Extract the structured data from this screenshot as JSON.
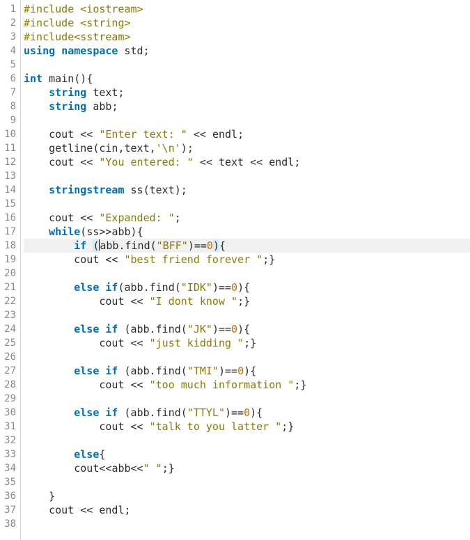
{
  "editor": {
    "highlighted_line": 18,
    "caret": {
      "line": 18,
      "col_after": "("
    },
    "line_count": 38,
    "lines": [
      {
        "n": 1,
        "tokens": [
          {
            "t": "#include ",
            "c": "pre"
          },
          {
            "t": "<iostream>",
            "c": "ang"
          }
        ]
      },
      {
        "n": 2,
        "tokens": [
          {
            "t": "#include ",
            "c": "pre"
          },
          {
            "t": "<string>",
            "c": "ang"
          }
        ]
      },
      {
        "n": 3,
        "tokens": [
          {
            "t": "#include",
            "c": "pre"
          },
          {
            "t": "<sstream>",
            "c": "ang"
          }
        ]
      },
      {
        "n": 4,
        "tokens": [
          {
            "t": "using",
            "c": "kw"
          },
          {
            "t": " ",
            "c": "id"
          },
          {
            "t": "namespace",
            "c": "kw"
          },
          {
            "t": " ",
            "c": "id"
          },
          {
            "t": "std",
            "c": "id"
          },
          {
            "t": ";",
            "c": "pun"
          }
        ]
      },
      {
        "n": 5,
        "tokens": []
      },
      {
        "n": 6,
        "tokens": [
          {
            "t": "int",
            "c": "type"
          },
          {
            "t": " ",
            "c": "id"
          },
          {
            "t": "main",
            "c": "func"
          },
          {
            "t": "()",
            "c": "pun"
          },
          {
            "t": "{",
            "c": "br"
          }
        ]
      },
      {
        "n": 7,
        "tokens": [
          {
            "t": "    ",
            "c": "id"
          },
          {
            "t": "string",
            "c": "type"
          },
          {
            "t": " ",
            "c": "id"
          },
          {
            "t": "text",
            "c": "id"
          },
          {
            "t": ";",
            "c": "pun"
          }
        ]
      },
      {
        "n": 8,
        "tokens": [
          {
            "t": "    ",
            "c": "id"
          },
          {
            "t": "string",
            "c": "type"
          },
          {
            "t": " ",
            "c": "id"
          },
          {
            "t": "abb",
            "c": "id"
          },
          {
            "t": ";",
            "c": "pun"
          }
        ]
      },
      {
        "n": 9,
        "tokens": []
      },
      {
        "n": 10,
        "tokens": [
          {
            "t": "    ",
            "c": "id"
          },
          {
            "t": "cout",
            "c": "id"
          },
          {
            "t": " ",
            "c": "id"
          },
          {
            "t": "<<",
            "c": "op"
          },
          {
            "t": " ",
            "c": "id"
          },
          {
            "t": "\"Enter text: \"",
            "c": "str"
          },
          {
            "t": " ",
            "c": "id"
          },
          {
            "t": "<<",
            "c": "op"
          },
          {
            "t": " ",
            "c": "id"
          },
          {
            "t": "endl",
            "c": "id"
          },
          {
            "t": ";",
            "c": "pun"
          }
        ]
      },
      {
        "n": 11,
        "tokens": [
          {
            "t": "    ",
            "c": "id"
          },
          {
            "t": "getline",
            "c": "func"
          },
          {
            "t": "(",
            "c": "pun"
          },
          {
            "t": "cin",
            "c": "id"
          },
          {
            "t": ",",
            "c": "pun"
          },
          {
            "t": "text",
            "c": "id"
          },
          {
            "t": ",",
            "c": "pun"
          },
          {
            "t": "'\\n'",
            "c": "str"
          },
          {
            "t": ")",
            "c": "pun"
          },
          {
            "t": ";",
            "c": "pun"
          }
        ]
      },
      {
        "n": 12,
        "tokens": [
          {
            "t": "    ",
            "c": "id"
          },
          {
            "t": "cout",
            "c": "id"
          },
          {
            "t": " ",
            "c": "id"
          },
          {
            "t": "<<",
            "c": "op"
          },
          {
            "t": " ",
            "c": "id"
          },
          {
            "t": "\"You entered: \"",
            "c": "str"
          },
          {
            "t": " ",
            "c": "id"
          },
          {
            "t": "<<",
            "c": "op"
          },
          {
            "t": " ",
            "c": "id"
          },
          {
            "t": "text",
            "c": "id"
          },
          {
            "t": " ",
            "c": "id"
          },
          {
            "t": "<<",
            "c": "op"
          },
          {
            "t": " ",
            "c": "id"
          },
          {
            "t": "endl",
            "c": "id"
          },
          {
            "t": ";",
            "c": "pun"
          }
        ]
      },
      {
        "n": 13,
        "tokens": []
      },
      {
        "n": 14,
        "tokens": [
          {
            "t": "    ",
            "c": "id"
          },
          {
            "t": "stringstream",
            "c": "type"
          },
          {
            "t": " ",
            "c": "id"
          },
          {
            "t": "ss",
            "c": "id"
          },
          {
            "t": "(",
            "c": "pun"
          },
          {
            "t": "text",
            "c": "id"
          },
          {
            "t": ")",
            "c": "pun"
          },
          {
            "t": ";",
            "c": "pun"
          }
        ]
      },
      {
        "n": 15,
        "tokens": []
      },
      {
        "n": 16,
        "tokens": [
          {
            "t": "    ",
            "c": "id"
          },
          {
            "t": "cout",
            "c": "id"
          },
          {
            "t": " ",
            "c": "id"
          },
          {
            "t": "<<",
            "c": "op"
          },
          {
            "t": " ",
            "c": "id"
          },
          {
            "t": "\"Expanded: \"",
            "c": "str"
          },
          {
            "t": ";",
            "c": "pun"
          }
        ]
      },
      {
        "n": 17,
        "tokens": [
          {
            "t": "    ",
            "c": "id"
          },
          {
            "t": "while",
            "c": "kw"
          },
          {
            "t": "(",
            "c": "pun"
          },
          {
            "t": "ss",
            "c": "id"
          },
          {
            "t": ">>",
            "c": "op"
          },
          {
            "t": "abb",
            "c": "id"
          },
          {
            "t": ")",
            "c": "pun"
          },
          {
            "t": "{",
            "c": "br"
          }
        ]
      },
      {
        "n": 18,
        "hl": true,
        "tokens": [
          {
            "t": "        ",
            "c": "id"
          },
          {
            "t": "if",
            "c": "kw"
          },
          {
            "t": " ",
            "c": "id"
          },
          {
            "t": "(",
            "c": "brh"
          },
          {
            "caret": true
          },
          {
            "t": "abb",
            "c": "id"
          },
          {
            "t": ".",
            "c": "pun"
          },
          {
            "t": "find",
            "c": "func"
          },
          {
            "t": "(",
            "c": "pun"
          },
          {
            "t": "\"BFF\"",
            "c": "str"
          },
          {
            "t": ")",
            "c": "pun"
          },
          {
            "t": "==",
            "c": "op"
          },
          {
            "t": "0",
            "c": "num"
          },
          {
            "t": ")",
            "c": "brh"
          },
          {
            "t": "{",
            "c": "br"
          }
        ]
      },
      {
        "n": 19,
        "tokens": [
          {
            "t": "        ",
            "c": "id"
          },
          {
            "t": "cout",
            "c": "id"
          },
          {
            "t": " ",
            "c": "id"
          },
          {
            "t": "<<",
            "c": "op"
          },
          {
            "t": " ",
            "c": "id"
          },
          {
            "t": "\"best friend forever \"",
            "c": "str"
          },
          {
            "t": ";",
            "c": "pun"
          },
          {
            "t": "}",
            "c": "br"
          }
        ]
      },
      {
        "n": 20,
        "tokens": []
      },
      {
        "n": 21,
        "tokens": [
          {
            "t": "        ",
            "c": "id"
          },
          {
            "t": "else",
            "c": "kw"
          },
          {
            "t": " ",
            "c": "id"
          },
          {
            "t": "if",
            "c": "kw"
          },
          {
            "t": "(",
            "c": "pun"
          },
          {
            "t": "abb",
            "c": "id"
          },
          {
            "t": ".",
            "c": "pun"
          },
          {
            "t": "find",
            "c": "func"
          },
          {
            "t": "(",
            "c": "pun"
          },
          {
            "t": "\"IDK\"",
            "c": "str"
          },
          {
            "t": ")",
            "c": "pun"
          },
          {
            "t": "==",
            "c": "op"
          },
          {
            "t": "0",
            "c": "num"
          },
          {
            "t": ")",
            "c": "pun"
          },
          {
            "t": "{",
            "c": "br"
          }
        ]
      },
      {
        "n": 22,
        "tokens": [
          {
            "t": "            ",
            "c": "id"
          },
          {
            "t": "cout",
            "c": "id"
          },
          {
            "t": " ",
            "c": "id"
          },
          {
            "t": "<<",
            "c": "op"
          },
          {
            "t": " ",
            "c": "id"
          },
          {
            "t": "\"I dont know \"",
            "c": "str"
          },
          {
            "t": ";",
            "c": "pun"
          },
          {
            "t": "}",
            "c": "br"
          }
        ]
      },
      {
        "n": 23,
        "tokens": []
      },
      {
        "n": 24,
        "tokens": [
          {
            "t": "        ",
            "c": "id"
          },
          {
            "t": "else",
            "c": "kw"
          },
          {
            "t": " ",
            "c": "id"
          },
          {
            "t": "if",
            "c": "kw"
          },
          {
            "t": " ",
            "c": "id"
          },
          {
            "t": "(",
            "c": "pun"
          },
          {
            "t": "abb",
            "c": "id"
          },
          {
            "t": ".",
            "c": "pun"
          },
          {
            "t": "find",
            "c": "func"
          },
          {
            "t": "(",
            "c": "pun"
          },
          {
            "t": "\"JK\"",
            "c": "str"
          },
          {
            "t": ")",
            "c": "pun"
          },
          {
            "t": "==",
            "c": "op"
          },
          {
            "t": "0",
            "c": "num"
          },
          {
            "t": ")",
            "c": "pun"
          },
          {
            "t": "{",
            "c": "br"
          }
        ]
      },
      {
        "n": 25,
        "tokens": [
          {
            "t": "            ",
            "c": "id"
          },
          {
            "t": "cout",
            "c": "id"
          },
          {
            "t": " ",
            "c": "id"
          },
          {
            "t": "<<",
            "c": "op"
          },
          {
            "t": " ",
            "c": "id"
          },
          {
            "t": "\"just kidding \"",
            "c": "str"
          },
          {
            "t": ";",
            "c": "pun"
          },
          {
            "t": "}",
            "c": "br"
          }
        ]
      },
      {
        "n": 26,
        "tokens": []
      },
      {
        "n": 27,
        "tokens": [
          {
            "t": "        ",
            "c": "id"
          },
          {
            "t": "else",
            "c": "kw"
          },
          {
            "t": " ",
            "c": "id"
          },
          {
            "t": "if",
            "c": "kw"
          },
          {
            "t": " ",
            "c": "id"
          },
          {
            "t": "(",
            "c": "pun"
          },
          {
            "t": "abb",
            "c": "id"
          },
          {
            "t": ".",
            "c": "pun"
          },
          {
            "t": "find",
            "c": "func"
          },
          {
            "t": "(",
            "c": "pun"
          },
          {
            "t": "\"TMI\"",
            "c": "str"
          },
          {
            "t": ")",
            "c": "pun"
          },
          {
            "t": "==",
            "c": "op"
          },
          {
            "t": "0",
            "c": "num"
          },
          {
            "t": ")",
            "c": "pun"
          },
          {
            "t": "{",
            "c": "br"
          }
        ]
      },
      {
        "n": 28,
        "tokens": [
          {
            "t": "            ",
            "c": "id"
          },
          {
            "t": "cout",
            "c": "id"
          },
          {
            "t": " ",
            "c": "id"
          },
          {
            "t": "<<",
            "c": "op"
          },
          {
            "t": " ",
            "c": "id"
          },
          {
            "t": "\"too much information \"",
            "c": "str"
          },
          {
            "t": ";",
            "c": "pun"
          },
          {
            "t": "}",
            "c": "br"
          }
        ]
      },
      {
        "n": 29,
        "tokens": []
      },
      {
        "n": 30,
        "tokens": [
          {
            "t": "        ",
            "c": "id"
          },
          {
            "t": "else",
            "c": "kw"
          },
          {
            "t": " ",
            "c": "id"
          },
          {
            "t": "if",
            "c": "kw"
          },
          {
            "t": " ",
            "c": "id"
          },
          {
            "t": "(",
            "c": "pun"
          },
          {
            "t": "abb",
            "c": "id"
          },
          {
            "t": ".",
            "c": "pun"
          },
          {
            "t": "find",
            "c": "func"
          },
          {
            "t": "(",
            "c": "pun"
          },
          {
            "t": "\"TTYL\"",
            "c": "str"
          },
          {
            "t": ")",
            "c": "pun"
          },
          {
            "t": "==",
            "c": "op"
          },
          {
            "t": "0",
            "c": "num"
          },
          {
            "t": ")",
            "c": "pun"
          },
          {
            "t": "{",
            "c": "br"
          }
        ]
      },
      {
        "n": 31,
        "tokens": [
          {
            "t": "            ",
            "c": "id"
          },
          {
            "t": "cout",
            "c": "id"
          },
          {
            "t": " ",
            "c": "id"
          },
          {
            "t": "<<",
            "c": "op"
          },
          {
            "t": " ",
            "c": "id"
          },
          {
            "t": "\"talk to you latter \"",
            "c": "str"
          },
          {
            "t": ";",
            "c": "pun"
          },
          {
            "t": "}",
            "c": "br"
          }
        ]
      },
      {
        "n": 32,
        "tokens": []
      },
      {
        "n": 33,
        "tokens": [
          {
            "t": "        ",
            "c": "id"
          },
          {
            "t": "else",
            "c": "kw"
          },
          {
            "t": "{",
            "c": "br"
          }
        ]
      },
      {
        "n": 34,
        "tokens": [
          {
            "t": "        ",
            "c": "id"
          },
          {
            "t": "cout",
            "c": "id"
          },
          {
            "t": "<<",
            "c": "op"
          },
          {
            "t": "abb",
            "c": "id"
          },
          {
            "t": "<<",
            "c": "op"
          },
          {
            "t": "\" \"",
            "c": "str"
          },
          {
            "t": ";",
            "c": "pun"
          },
          {
            "t": "}",
            "c": "br"
          }
        ]
      },
      {
        "n": 35,
        "tokens": []
      },
      {
        "n": 36,
        "tokens": [
          {
            "t": "    ",
            "c": "id"
          },
          {
            "t": "}",
            "c": "br"
          }
        ]
      },
      {
        "n": 37,
        "tokens": [
          {
            "t": "    ",
            "c": "id"
          },
          {
            "t": "cout",
            "c": "id"
          },
          {
            "t": " ",
            "c": "id"
          },
          {
            "t": "<<",
            "c": "op"
          },
          {
            "t": " ",
            "c": "id"
          },
          {
            "t": "endl",
            "c": "id"
          },
          {
            "t": ";",
            "c": "pun"
          }
        ]
      },
      {
        "n": 38,
        "tokens": []
      }
    ]
  }
}
